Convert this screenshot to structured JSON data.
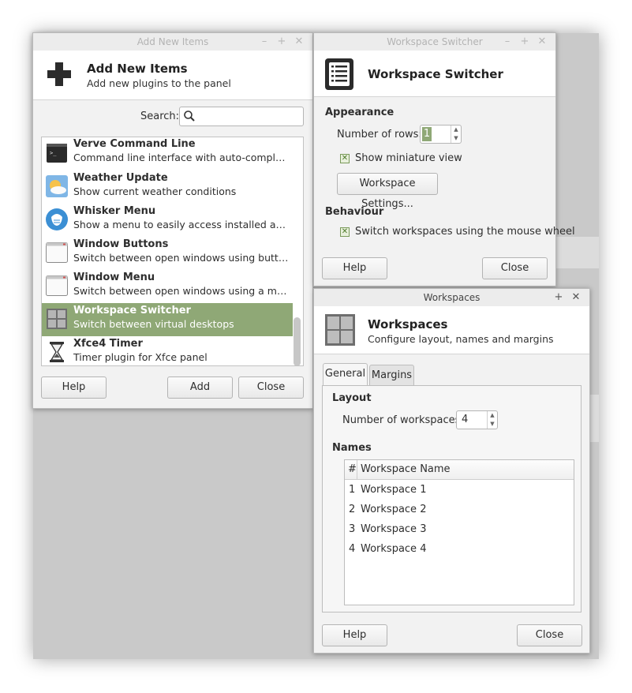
{
  "add_items": {
    "window_title": "Add New Items",
    "header_title": "Add New Items",
    "header_subtitle": "Add new plugins to the panel",
    "search_label": "Search:",
    "search_value": "",
    "plugins": [
      {
        "name": "Verve Command Line",
        "desc": "Command line interface with auto-completion a...",
        "icon": "terminal-icon"
      },
      {
        "name": "Weather Update",
        "desc": "Show current weather conditions",
        "icon": "weather-icon"
      },
      {
        "name": "Whisker Menu",
        "desc": "Show a menu to easily access installed applicat...",
        "icon": "whisker-menu-icon"
      },
      {
        "name": "Window Buttons",
        "desc": "Switch between open windows using buttons",
        "icon": "window-buttons-icon"
      },
      {
        "name": "Window Menu",
        "desc": "Switch between open windows using a menu",
        "icon": "window-menu-icon"
      },
      {
        "name": "Workspace Switcher",
        "desc": "Switch between virtual desktops",
        "icon": "workspace-switcher-icon"
      },
      {
        "name": "Xfce4 Timer",
        "desc": "Timer plugin for Xfce panel",
        "icon": "hourglass-icon"
      }
    ],
    "selected_index": 5,
    "help_label": "Help",
    "add_label": "Add",
    "close_label": "Close"
  },
  "switcher": {
    "window_title": "Workspace Switcher",
    "header_title": "Workspace Switcher",
    "appearance_label": "Appearance",
    "rows_label": "Number of rows:",
    "rows_value": "1",
    "miniature_label": "Show miniature view",
    "miniature_checked": true,
    "settings_button": "Workspace Settings...",
    "behaviour_label": "Behaviour",
    "wheel_label": "Switch workspaces using the mouse wheel",
    "wheel_checked": true,
    "help_label": "Help",
    "close_label": "Close"
  },
  "workspaces": {
    "window_title": "Workspaces",
    "header_title": "Workspaces",
    "header_subtitle": "Configure layout, names and margins",
    "tabs": [
      "General",
      "Margins"
    ],
    "active_tab": 0,
    "layout_label": "Layout",
    "count_label": "Number of workspaces:",
    "count_value": "4",
    "names_label": "Names",
    "col_hash": "#",
    "col_name": "Workspace Name",
    "rows": [
      {
        "num": "1",
        "name": "Workspace 1"
      },
      {
        "num": "2",
        "name": "Workspace 2"
      },
      {
        "num": "3",
        "name": "Workspace 3"
      },
      {
        "num": "4",
        "name": "Workspace 4"
      }
    ],
    "help_label": "Help",
    "close_label": "Close"
  },
  "titlebar_glyphs": {
    "minimize": "–",
    "maximize": "+",
    "close": "✕"
  },
  "colors": {
    "selection": "#8fa876",
    "accent_check": "#4d7a2a"
  }
}
